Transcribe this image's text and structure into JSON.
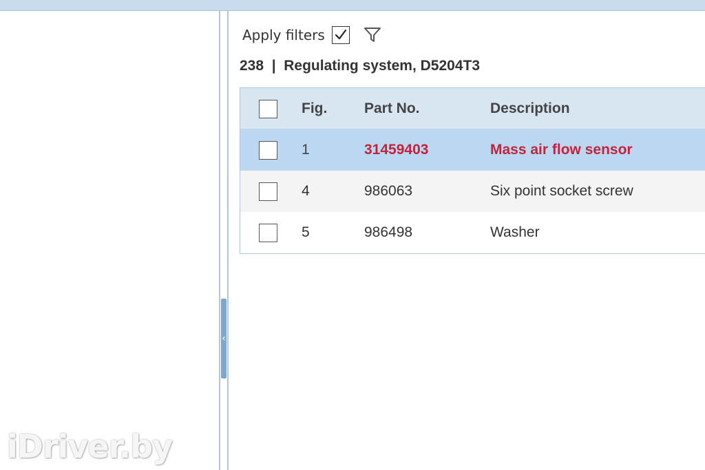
{
  "filters": {
    "label": "Apply filters",
    "checked": true,
    "icon": "funnel-icon"
  },
  "section": {
    "title": "238  |  Regulating system, D5204T3"
  },
  "table": {
    "columns": {
      "fig": "Fig.",
      "part_no": "Part No.",
      "description": "Description"
    },
    "rows": [
      {
        "fig": "1",
        "part_no": "31459403",
        "description": "Mass air flow sensor",
        "selected": true
      },
      {
        "fig": "4",
        "part_no": "986063",
        "description": "Six point socket screw",
        "selected": false
      },
      {
        "fig": "5",
        "part_no": "986498",
        "description": "Washer",
        "selected": false
      }
    ]
  },
  "colors": {
    "selected_text": "#c0253b",
    "selected_row": "#bcd7f1",
    "header_row": "#d8e6f2",
    "border": "#aec6de"
  },
  "watermark": "iDriver.by"
}
